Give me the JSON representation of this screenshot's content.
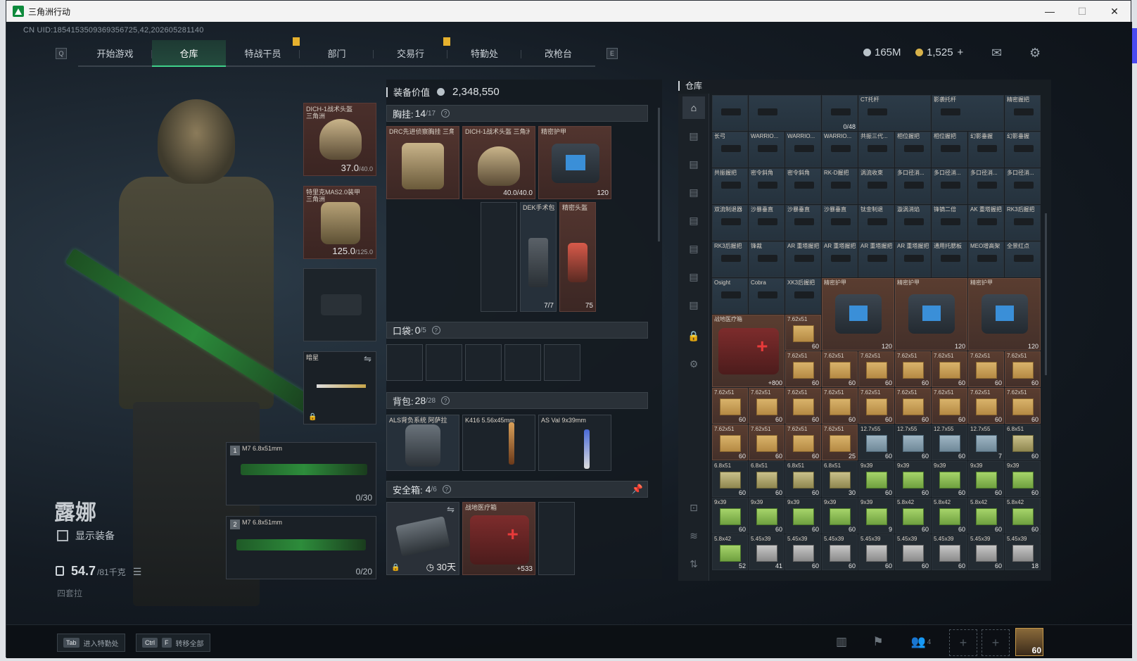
{
  "window": {
    "title": "三角洲行动",
    "minimize": "—",
    "maximize": "☐",
    "close": "✕"
  },
  "header": {
    "uid": "CN UID:1854153509369356725,42,202605281140",
    "nav_key_left": "Q",
    "nav_key_right": "E",
    "tabs": [
      "开始游戏",
      "仓库",
      "特战干员",
      "部门",
      "交易行",
      "特勤处",
      "改枪台"
    ],
    "active_tab": 1,
    "currency1": "165M",
    "currency2": "1,525",
    "currency2_plus": "+"
  },
  "character": {
    "name": "露娜",
    "show_equip_label": "显示装备",
    "weight_value": "54.7",
    "weight_max": "/81千克",
    "sub_label": "四套拉"
  },
  "equip": {
    "helmet_label": "DICH-1战术头盔 三角洲",
    "helmet_dur": "37.0",
    "helmet_max": "/40.0",
    "armor_label": "特里克MAS2.0装甲 三角洲",
    "armor_dur": "125.0",
    "armor_max": "/125.0",
    "melee_label": "暗星",
    "weapon1_num": "1",
    "weapon1_label": "M7 6.8x51mm",
    "weapon1_ammo": "0/30",
    "weapon2_num": "2",
    "weapon2_label": "M7 6.8x51mm",
    "weapon2_ammo": "0/20"
  },
  "mid": {
    "value_label": "装备价值",
    "value_amount": "2,348,550",
    "chest_label": "胸挂:",
    "chest_count": "14",
    "chest_cap": "/17",
    "chest_items": [
      {
        "label": "DRC先进侦察胸挂 三角洲"
      },
      {
        "label": "DICH-1战术头盔 三角洲",
        "dur": "40.0/40.0"
      },
      {
        "label": "精密护甲",
        "dur": "120"
      },
      {
        "label": "DEK手术包",
        "dur": "7/7"
      },
      {
        "label": "精密头盔",
        "dur": "75"
      }
    ],
    "pocket_label": "口袋:",
    "pocket_count": "0",
    "pocket_cap": "/5",
    "backpack_label": "背包:",
    "backpack_count": "28",
    "backpack_cap": "/28",
    "backpack_items": [
      {
        "label": "ALS背负系统 阿萨拉"
      },
      {
        "label": "K416 5.56x45mm"
      },
      {
        "label": "AS Val 9x39mm"
      }
    ],
    "safe_label": "安全箱:",
    "safe_count": "4",
    "safe_cap": "/6",
    "safe_timer": "30天",
    "safe_item_label": "战地医疗箱",
    "safe_item_qty": "+533"
  },
  "storage": {
    "title": "仓库",
    "cells": [
      {
        "r": 0,
        "c": 0,
        "w": 1,
        "h": 1,
        "lbl": "",
        "q": "",
        "t": "part"
      },
      {
        "r": 0,
        "c": 1,
        "w": 2,
        "h": 1,
        "lbl": "",
        "q": "",
        "t": "part"
      },
      {
        "r": 0,
        "c": 3,
        "w": 1,
        "h": 1,
        "lbl": "",
        "q": "0/48",
        "t": "part"
      },
      {
        "r": 0,
        "c": 4,
        "w": 2,
        "h": 1,
        "lbl": "CT托杆",
        "q": "",
        "t": "part"
      },
      {
        "r": 0,
        "c": 6,
        "w": 2,
        "h": 1,
        "lbl": "影袭托杆",
        "q": "",
        "t": "part"
      },
      {
        "r": 0,
        "c": 8,
        "w": 1,
        "h": 1,
        "lbl": "精密握把",
        "q": "",
        "t": "part"
      },
      {
        "r": 1,
        "c": 0,
        "lbl": "长弓",
        "q": "",
        "t": "part"
      },
      {
        "r": 1,
        "c": 1,
        "lbl": "WARRIO...",
        "q": "",
        "t": "part"
      },
      {
        "r": 1,
        "c": 2,
        "lbl": "WARRIO...",
        "q": "",
        "t": "part"
      },
      {
        "r": 1,
        "c": 3,
        "lbl": "WARRIO...",
        "q": "",
        "t": "part"
      },
      {
        "r": 1,
        "c": 4,
        "lbl": "共振三代...",
        "q": "",
        "t": "part"
      },
      {
        "r": 1,
        "c": 5,
        "lbl": "相位握把",
        "q": "",
        "t": "part"
      },
      {
        "r": 1,
        "c": 6,
        "lbl": "相位握把",
        "q": "",
        "t": "part"
      },
      {
        "r": 1,
        "c": 7,
        "lbl": "幻影垂握",
        "q": "",
        "t": "part"
      },
      {
        "r": 1,
        "c": 8,
        "lbl": "幻影垂握",
        "q": "",
        "t": "part"
      },
      {
        "r": 2,
        "c": 0,
        "lbl": "共振握把",
        "q": "",
        "t": "part"
      },
      {
        "r": 2,
        "c": 1,
        "lbl": "密令斜角",
        "q": "",
        "t": "part"
      },
      {
        "r": 2,
        "c": 2,
        "lbl": "密令斜角",
        "q": "",
        "t": "part"
      },
      {
        "r": 2,
        "c": 3,
        "lbl": "RK-D握把",
        "q": "",
        "t": "part"
      },
      {
        "r": 2,
        "c": 4,
        "lbl": "涡流收束",
        "q": "",
        "t": "part"
      },
      {
        "r": 2,
        "c": 5,
        "lbl": "多口径消...",
        "q": "",
        "t": "part"
      },
      {
        "r": 2,
        "c": 6,
        "lbl": "多口径消...",
        "q": "",
        "t": "part"
      },
      {
        "r": 2,
        "c": 7,
        "lbl": "多口径消...",
        "q": "",
        "t": "part"
      },
      {
        "r": 2,
        "c": 8,
        "lbl": "多口径消...",
        "q": "",
        "t": "part"
      },
      {
        "r": 3,
        "c": 0,
        "lbl": "双流制退器",
        "q": "",
        "t": "part"
      },
      {
        "r": 3,
        "c": 1,
        "lbl": "沙暴垂直",
        "q": "",
        "t": "part"
      },
      {
        "r": 3,
        "c": 2,
        "lbl": "沙暴垂直",
        "q": "",
        "t": "part"
      },
      {
        "r": 3,
        "c": 3,
        "lbl": "沙暴垂直",
        "q": "",
        "t": "part"
      },
      {
        "r": 3,
        "c": 4,
        "lbl": "钛金制退",
        "q": "",
        "t": "part"
      },
      {
        "r": 3,
        "c": 5,
        "lbl": "漩涡消焰",
        "q": "",
        "t": "part"
      },
      {
        "r": 3,
        "c": 6,
        "lbl": "锋镝二倍",
        "q": "",
        "t": "part"
      },
      {
        "r": 3,
        "c": 7,
        "lbl": "AK 重塔握把",
        "q": "",
        "t": "part"
      },
      {
        "r": 3,
        "c": 8,
        "lbl": "RK3后握把",
        "q": "",
        "t": "part"
      },
      {
        "r": 4,
        "c": 0,
        "lbl": "RK3后握把",
        "q": "",
        "t": "part"
      },
      {
        "r": 4,
        "c": 1,
        "lbl": "锋裁",
        "q": "",
        "t": "part"
      },
      {
        "r": 4,
        "c": 2,
        "lbl": "AR 重塔握把",
        "q": "",
        "t": "part"
      },
      {
        "r": 4,
        "c": 3,
        "lbl": "AR 重塔握把",
        "q": "",
        "t": "part"
      },
      {
        "r": 4,
        "c": 4,
        "lbl": "AR 重塔握把",
        "q": "",
        "t": "part"
      },
      {
        "r": 4,
        "c": 5,
        "lbl": "AR 重塔握把",
        "q": "",
        "t": "part"
      },
      {
        "r": 4,
        "c": 6,
        "lbl": "通用托腮板",
        "q": "",
        "t": "part"
      },
      {
        "r": 4,
        "c": 7,
        "lbl": "MEO增高架",
        "q": "",
        "t": "part"
      },
      {
        "r": 4,
        "c": 8,
        "lbl": "全景红点",
        "q": "",
        "t": "part"
      },
      {
        "r": 5,
        "c": 0,
        "lbl": "Osight",
        "q": "",
        "t": "part"
      },
      {
        "r": 5,
        "c": 1,
        "lbl": "Cobra",
        "q": "",
        "t": "part"
      },
      {
        "r": 5,
        "c": 2,
        "lbl": "XK3后握把",
        "q": "",
        "t": "part"
      },
      {
        "r": 5,
        "c": 3,
        "w": 2,
        "h": 2,
        "lbl": "精密护甲",
        "q": "120",
        "t": "bag"
      },
      {
        "r": 5,
        "c": 5,
        "w": 2,
        "h": 2,
        "lbl": "精密护甲",
        "q": "120",
        "t": "bag"
      },
      {
        "r": 5,
        "c": 7,
        "w": 2,
        "h": 2,
        "lbl": "精密护甲",
        "q": "120",
        "t": "bag"
      },
      {
        "r": 6,
        "c": 0,
        "w": 2,
        "h": 2,
        "lbl": "战地医疗箱",
        "q": "+800",
        "t": "med"
      },
      {
        "r": 6,
        "c": 2,
        "lbl": "7.62x51",
        "q": "60",
        "t": "box"
      },
      {
        "r": 7,
        "c": 2,
        "lbl": "7.62x51",
        "q": "60",
        "t": "box"
      },
      {
        "r": 7,
        "c": 3,
        "lbl": "7.62x51",
        "q": "60",
        "t": "box"
      },
      {
        "r": 7,
        "c": 4,
        "lbl": "7.62x51",
        "q": "60",
        "t": "box"
      },
      {
        "r": 7,
        "c": 5,
        "lbl": "7.62x51",
        "q": "60",
        "t": "box"
      },
      {
        "r": 7,
        "c": 6,
        "lbl": "7.62x51",
        "q": "60",
        "t": "box"
      },
      {
        "r": 7,
        "c": 7,
        "lbl": "7.62x51",
        "q": "60",
        "t": "box"
      },
      {
        "r": 7,
        "c": 8,
        "lbl": "7.62x51",
        "q": "60",
        "t": "box"
      },
      {
        "r": 8,
        "c": 0,
        "lbl": "7.62x51",
        "q": "60",
        "t": "box"
      },
      {
        "r": 8,
        "c": 1,
        "lbl": "7.62x51",
        "q": "60",
        "t": "box"
      },
      {
        "r": 8,
        "c": 2,
        "lbl": "7.62x51",
        "q": "60",
        "t": "box"
      },
      {
        "r": 8,
        "c": 3,
        "lbl": "7.62x51",
        "q": "60",
        "t": "box"
      },
      {
        "r": 8,
        "c": 4,
        "lbl": "7.62x51",
        "q": "60",
        "t": "box"
      },
      {
        "r": 8,
        "c": 5,
        "lbl": "7.62x51",
        "q": "60",
        "t": "box"
      },
      {
        "r": 8,
        "c": 6,
        "lbl": "7.62x51",
        "q": "60",
        "t": "box"
      },
      {
        "r": 8,
        "c": 7,
        "lbl": "7.62x51",
        "q": "60",
        "t": "box"
      },
      {
        "r": 8,
        "c": 8,
        "lbl": "7.62x51",
        "q": "60",
        "t": "box"
      },
      {
        "r": 9,
        "c": 0,
        "lbl": "7.62x51",
        "q": "60",
        "t": "box"
      },
      {
        "r": 9,
        "c": 1,
        "lbl": "7.62x51",
        "q": "60",
        "t": "box"
      },
      {
        "r": 9,
        "c": 2,
        "lbl": "7.62x51",
        "q": "60",
        "t": "box"
      },
      {
        "r": 9,
        "c": 3,
        "lbl": "7.62x51",
        "q": "25",
        "t": "box"
      },
      {
        "r": 9,
        "c": 4,
        "lbl": "12.7x55",
        "q": "60",
        "t": "blue"
      },
      {
        "r": 9,
        "c": 5,
        "lbl": "12.7x55",
        "q": "60",
        "t": "blue"
      },
      {
        "r": 9,
        "c": 6,
        "lbl": "12.7x55",
        "q": "60",
        "t": "blue"
      },
      {
        "r": 9,
        "c": 7,
        "lbl": "12.7x55",
        "q": "7",
        "t": "blue"
      },
      {
        "r": 9,
        "c": 8,
        "lbl": "6.8x51",
        "q": "60",
        "t": "olive"
      },
      {
        "r": 10,
        "c": 0,
        "lbl": "6.8x51",
        "q": "60",
        "t": "olive"
      },
      {
        "r": 10,
        "c": 1,
        "lbl": "6.8x51",
        "q": "60",
        "t": "olive"
      },
      {
        "r": 10,
        "c": 2,
        "lbl": "6.8x51",
        "q": "60",
        "t": "olive"
      },
      {
        "r": 10,
        "c": 3,
        "lbl": "6.8x51",
        "q": "30",
        "t": "olive"
      },
      {
        "r": 10,
        "c": 4,
        "lbl": "9x39",
        "q": "60",
        "t": "green"
      },
      {
        "r": 10,
        "c": 5,
        "lbl": "9x39",
        "q": "60",
        "t": "green"
      },
      {
        "r": 10,
        "c": 6,
        "lbl": "9x39",
        "q": "60",
        "t": "green"
      },
      {
        "r": 10,
        "c": 7,
        "lbl": "9x39",
        "q": "60",
        "t": "green"
      },
      {
        "r": 10,
        "c": 8,
        "lbl": "9x39",
        "q": "60",
        "t": "green"
      },
      {
        "r": 11,
        "c": 0,
        "lbl": "9x39",
        "q": "60",
        "t": "green"
      },
      {
        "r": 11,
        "c": 1,
        "lbl": "9x39",
        "q": "60",
        "t": "green"
      },
      {
        "r": 11,
        "c": 2,
        "lbl": "9x39",
        "q": "60",
        "t": "green"
      },
      {
        "r": 11,
        "c": 3,
        "lbl": "9x39",
        "q": "60",
        "t": "green"
      },
      {
        "r": 11,
        "c": 4,
        "lbl": "9x39",
        "q": "9",
        "t": "green"
      },
      {
        "r": 11,
        "c": 5,
        "lbl": "5.8x42",
        "q": "60",
        "t": "green"
      },
      {
        "r": 11,
        "c": 6,
        "lbl": "5.8x42",
        "q": "60",
        "t": "green"
      },
      {
        "r": 11,
        "c": 7,
        "lbl": "5.8x42",
        "q": "60",
        "t": "green"
      },
      {
        "r": 11,
        "c": 8,
        "lbl": "5.8x42",
        "q": "60",
        "t": "green"
      },
      {
        "r": 12,
        "c": 0,
        "lbl": "5.8x42",
        "q": "52",
        "t": "green"
      },
      {
        "r": 12,
        "c": 1,
        "lbl": "5.45x39",
        "q": "41",
        "t": "gray"
      },
      {
        "r": 12,
        "c": 2,
        "lbl": "5.45x39",
        "q": "60",
        "t": "gray"
      },
      {
        "r": 12,
        "c": 3,
        "lbl": "5.45x39",
        "q": "60",
        "t": "gray"
      },
      {
        "r": 12,
        "c": 4,
        "lbl": "5.45x39",
        "q": "60",
        "t": "gray"
      },
      {
        "r": 12,
        "c": 5,
        "lbl": "5.45x39",
        "q": "60",
        "t": "gray"
      },
      {
        "r": 12,
        "c": 6,
        "lbl": "5.45x39",
        "q": "60",
        "t": "gray"
      },
      {
        "r": 12,
        "c": 7,
        "lbl": "5.45x39",
        "q": "60",
        "t": "gray"
      },
      {
        "r": 12,
        "c": 8,
        "lbl": "5.45x39",
        "q": "18",
        "t": "gray"
      }
    ]
  },
  "bottom": {
    "tab_key": "Tab",
    "tab_text": "进入特勤处",
    "ctrl_key": "Ctrl",
    "f_key": "F",
    "transfer_text": "转移全部",
    "squad_count": "4",
    "level": "60"
  },
  "colors": {
    "accent": "#3fd18a",
    "alert": "#e6b12e",
    "brown_cell": "#52352f"
  }
}
